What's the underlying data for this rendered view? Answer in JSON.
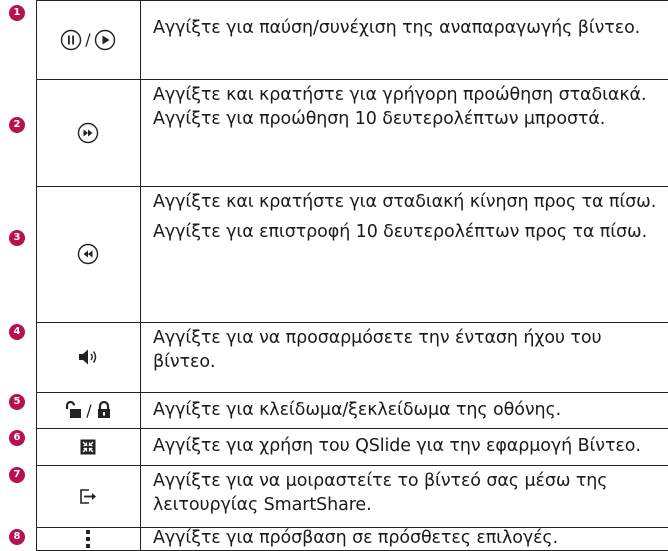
{
  "rows": [
    {
      "num": "1",
      "icon": "pause-play-icons",
      "separator": "/",
      "paragraphs": [
        "Αγγίξτε για παύση/συνέχιση της αναπαραγωγής βίντεο."
      ]
    },
    {
      "num": "2",
      "icon": "fast-forward-icon",
      "paragraphs": [
        "Αγγίξτε και κρατήστε για γρήγορη προώθηση σταδιακά. Αγγίξτε για προώθηση 10 δευτερολέπτων μπροστά."
      ]
    },
    {
      "num": "3",
      "icon": "rewind-icon",
      "paragraphs": [
        "Αγγίξτε και κρατήστε για σταδιακή κίνηση προς τα πίσω.",
        "Αγγίξτε για επιστροφή 10 δευτερολέπτων προς τα πίσω."
      ]
    },
    {
      "num": "4",
      "icon": "volume-icon",
      "paragraphs": [
        "Αγγίξτε για να προσαρμόσετε την ένταση ήχου του βίντεο."
      ]
    },
    {
      "num": "5",
      "icon": "lock-unlock-icons",
      "separator": "/",
      "paragraphs": [
        "Αγγίξτε για κλείδωμα/ξεκλείδωμα της οθόνης."
      ]
    },
    {
      "num": "6",
      "icon": "qslide-icon",
      "paragraphs": [
        "Αγγίξτε για χρήση του QSlide για την εφαρμογή Βίντεο."
      ]
    },
    {
      "num": "7",
      "icon": "smartshare-icon",
      "paragraphs": [
        "Αγγίξτε για να μοιραστείτε το βίντεό σας μέσω της λειτουργίας SmartShare."
      ]
    },
    {
      "num": "8",
      "icon": "more-options-icon",
      "paragraphs": [
        "Αγγίξτε για πρόσβαση σε πρόσθετες επιλογές."
      ]
    }
  ],
  "colors": {
    "badge": "#b5124f",
    "lines": "#222222"
  }
}
